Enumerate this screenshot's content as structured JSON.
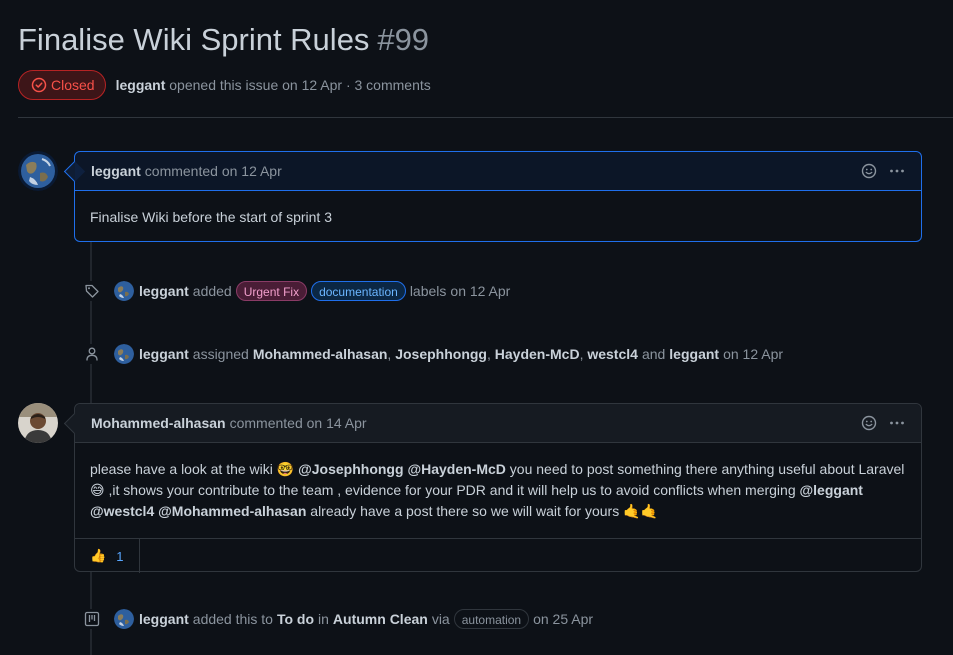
{
  "issue": {
    "title": "Finalise Wiki Sprint Rules",
    "number": "#99",
    "state": "Closed",
    "author": "leggant",
    "opened_text": "opened this issue on 12 Apr · 3 comments"
  },
  "comment1": {
    "author": "leggant",
    "meta": "commented on 12 Apr",
    "body": "Finalise Wiki before the start of sprint 3"
  },
  "event_labels": {
    "actor": "leggant",
    "verb": "added",
    "labels": [
      "Urgent Fix",
      "documentation"
    ],
    "suffix": "labels",
    "date": "on 12 Apr"
  },
  "event_assign": {
    "actor": "leggant",
    "verb": "assigned",
    "assignees": [
      "Mohammed-alhasan",
      "Josephhongg",
      "Hayden-McD",
      "westcl4"
    ],
    "and_text": "and",
    "last_assignee": "leggant",
    "date": "on 12 Apr"
  },
  "comment2": {
    "author": "Mohammed-alhasan",
    "meta": "commented on 14 Apr",
    "body_parts": {
      "p1": "please have a look at the wiki",
      "emoji1": "🤓",
      "m1": "@Josephhongg",
      "m2": "@Hayden-McD",
      "p2": "you need to post something there anything useful about Laravel",
      "emoji2": "😅",
      "p3": ",it shows your contribute to the team , evidence for your PDR and it will help us to avoid conflicts when merging",
      "m3": "@leggant",
      "m4": "@westcl4",
      "m5": "@Mohammed-alhasan",
      "p4": "already have a post there so we will wait for yours",
      "emoji3": "🤙🤙"
    },
    "reaction": {
      "emoji": "👍",
      "count": "1"
    }
  },
  "event_project": {
    "actor": "leggant",
    "t1": "added this to",
    "column": "To do",
    "t2": "in",
    "project": "Autumn Clean",
    "t3": "via",
    "via_label": "automation",
    "date": "on 25 Apr"
  },
  "colors": {
    "closed": "#f85149",
    "link": "#58a6ff",
    "owner_border": "#1f6feb",
    "urgent_label": "#f29fcc",
    "doc_label": "#6cb6ff"
  }
}
